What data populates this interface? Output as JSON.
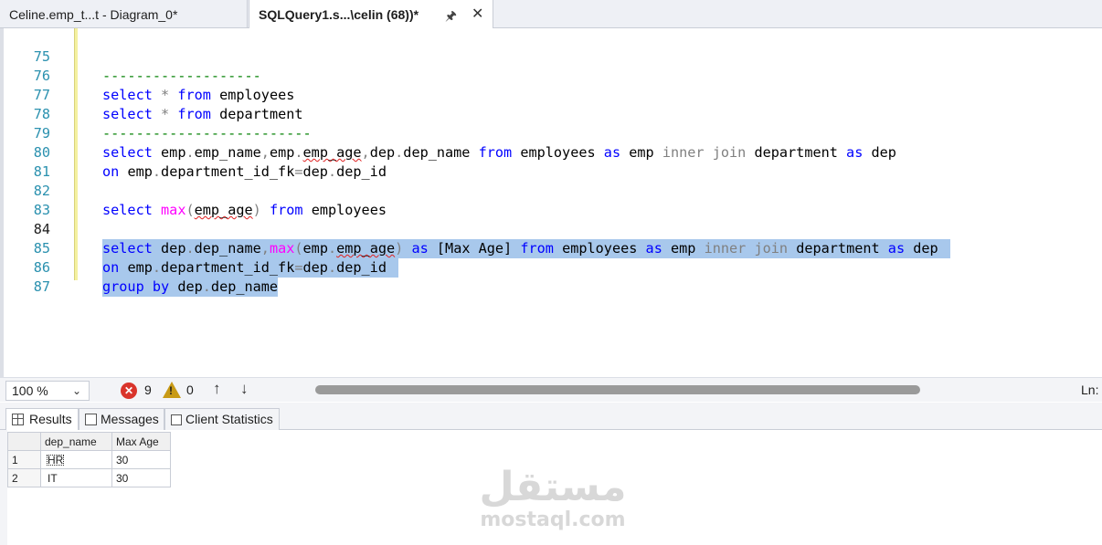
{
  "tabs": [
    {
      "label": "Celine.emp_t...t - Diagram_0*"
    },
    {
      "label": "SQLQuery1.s...\\celin (68))*",
      "pin_icon": "pin-icon",
      "close_icon": "close-icon"
    }
  ],
  "editor": {
    "lines": [
      {
        "num": "75"
      },
      {
        "num": "76"
      },
      {
        "num": "77"
      },
      {
        "num": "78"
      },
      {
        "num": "79"
      },
      {
        "num": "80"
      },
      {
        "num": "81"
      },
      {
        "num": "82"
      },
      {
        "num": "83"
      },
      {
        "num": "84"
      },
      {
        "num": "85"
      },
      {
        "num": "86"
      },
      {
        "num": "87"
      }
    ],
    "tokens": {
      "dashes_short": "-------------------",
      "dashes_long": "-------------------------",
      "select": "select",
      "star": "*",
      "from": "from",
      "employees": "employees",
      "department": "department",
      "emp_prefix": "emp",
      "emp_name": "emp_name",
      "emp_age": "emp_age",
      "dep": "dep",
      "dep_name": "dep_name",
      "as": "as",
      "inner": "inner",
      "join": "join",
      "on": "on",
      "department_id_fk": "department_id_fk",
      "dep_id": "dep_id",
      "max": "max",
      "max_age_alias": "[Max Age]",
      "group": "group",
      "by": "by"
    }
  },
  "status": {
    "zoom": "100 %",
    "errors": "9",
    "warnings": "0",
    "ln_label": "Ln:"
  },
  "results": {
    "tabs": [
      {
        "label": "Results"
      },
      {
        "label": "Messages"
      },
      {
        "label": "Client Statistics"
      }
    ],
    "columns": [
      "dep_name",
      "Max Age"
    ],
    "rows": [
      {
        "num": "1",
        "dep_name": "HR",
        "max_age": "30"
      },
      {
        "num": "2",
        "dep_name": "IT",
        "max_age": "30"
      }
    ]
  },
  "watermark": {
    "arabic": "مستقل",
    "latin": "mostaql.com"
  },
  "colors": {
    "keyword": "#0000ff",
    "function": "#ff00ff",
    "operator_gray": "#808080",
    "selection": "#a8c8ec",
    "line_number": "#2b91af",
    "error_badge": "#d9342b",
    "warning_icon": "#c89a16"
  }
}
